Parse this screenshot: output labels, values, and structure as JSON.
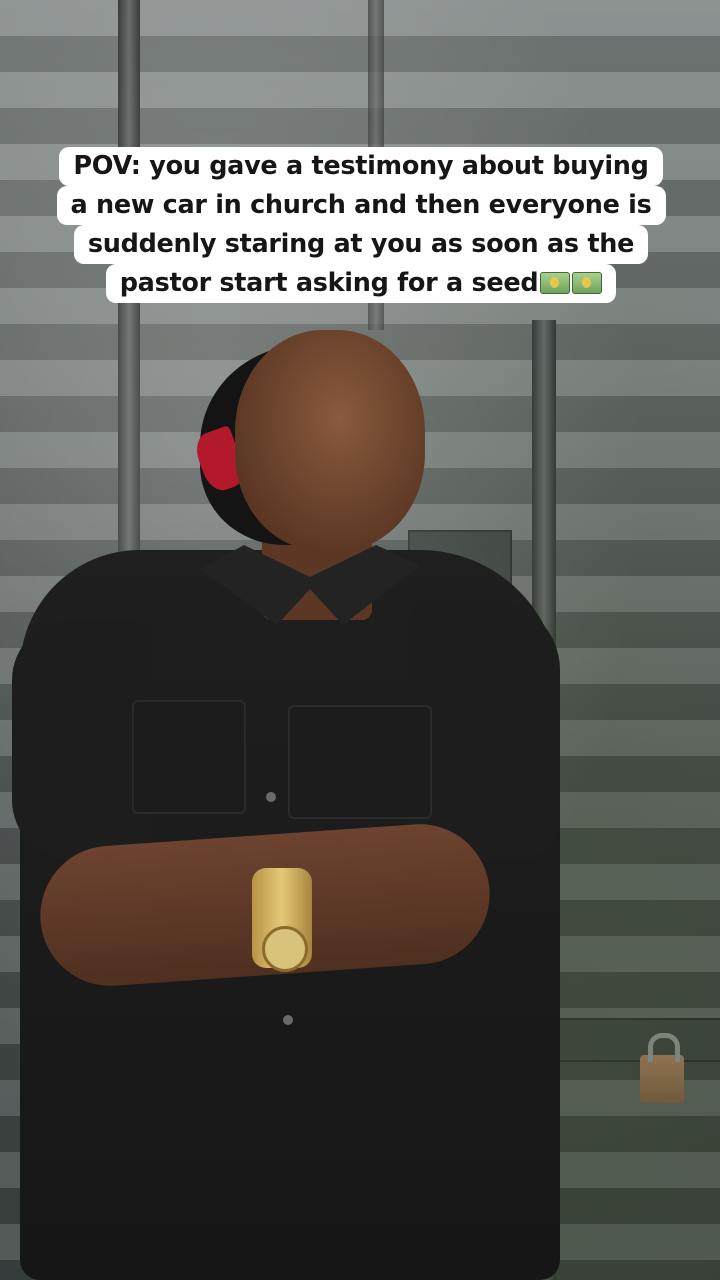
{
  "caption": {
    "lines": [
      "POV: you gave a testimony about buying",
      "a new car in church and then everyone is",
      "suddenly staring at you as soon as the",
      "pastor start asking for a seed"
    ],
    "emojis": [
      "money-with-dollar-emoji",
      "euro-banknote-emoji"
    ]
  },
  "colors": {
    "caption_bg": "#ffffff",
    "caption_text": "#161616"
  }
}
